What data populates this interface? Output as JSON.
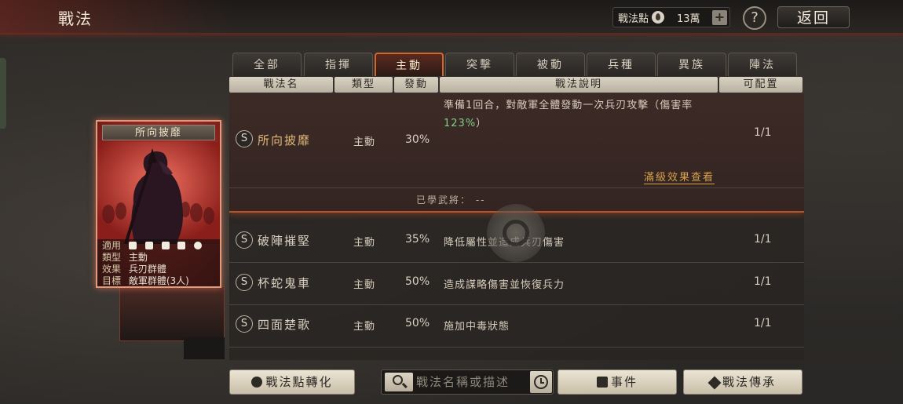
{
  "header": {
    "title": "戰法",
    "points_label": "戰法點",
    "points_value": "13萬",
    "plus": "+",
    "help": "?",
    "back": "返回"
  },
  "tabs": [
    {
      "label": "全部",
      "active": false
    },
    {
      "label": "指揮",
      "active": false
    },
    {
      "label": "主動",
      "active": true
    },
    {
      "label": "突擊",
      "active": false
    },
    {
      "label": "被動",
      "active": false
    },
    {
      "label": "兵種",
      "active": false
    },
    {
      "label": "異族",
      "active": false
    },
    {
      "label": "陣法",
      "active": false
    }
  ],
  "columns": [
    "戰法名",
    "類型",
    "發動",
    "戰法說明",
    "可配置"
  ],
  "selected": {
    "grade": "S",
    "name": "所向披靡",
    "type": "主動",
    "rate": "30%",
    "desc_part1": "準備1回合，對敵軍全體發動一次兵刃攻擊（傷害率",
    "desc_highlight": "123%",
    "desc_part2": "）",
    "slots": "1/1",
    "full_effect_link": "滿級效果查看",
    "learned_label": "已學武將：",
    "learned_value": "--"
  },
  "rows": [
    {
      "grade": "S",
      "name": "破陣摧堅",
      "type": "主動",
      "rate": "35%",
      "desc": "降低屬性並造成兵刃傷害",
      "slots": "1/1"
    },
    {
      "grade": "S",
      "name": "杯蛇鬼車",
      "type": "主動",
      "rate": "50%",
      "desc": "造成謀略傷害並恢復兵力",
      "slots": "1/1"
    },
    {
      "grade": "S",
      "name": "四面楚歌",
      "type": "主動",
      "rate": "50%",
      "desc": "施加中毒狀態",
      "slots": "1/1"
    }
  ],
  "card": {
    "title": "所向披靡",
    "info": {
      "apply_key": "適用",
      "type_key": "類型",
      "type_value": "主動",
      "effect_key": "效果",
      "effect_value": "兵刃群體",
      "target_key": "目標",
      "target_value": "敵軍群體(3人)"
    }
  },
  "bottom": {
    "convert_button": "戰法點轉化",
    "search_placeholder": "戰法名稱或描述",
    "event_button": "事件",
    "inherit_button": "戰法傳承"
  }
}
